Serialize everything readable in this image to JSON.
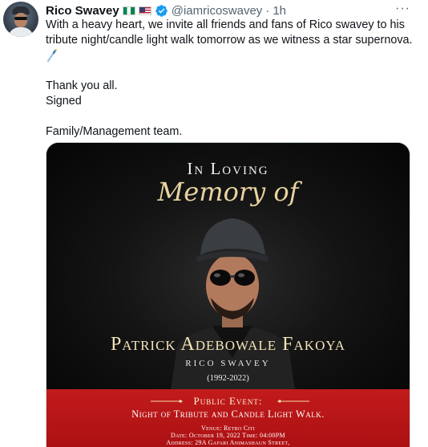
{
  "tweet": {
    "display_name": "Rico Swavey",
    "handle": "@iamricoswavey",
    "separator": "·",
    "time": "1h",
    "more_label": "···",
    "body": {
      "line1": "With a heavy heart, we invite all  friends and fans of Rico swavey to his",
      "line2": "tribute night/candle light walk tomorrow as we witness a star supernova.",
      "thanks": "Thank you all.",
      "signed": "Signed",
      "signature": "Family/Management team."
    },
    "icons": {
      "flag1": "nigeria-flag-icon",
      "flag2": "us-flag-icon",
      "verified": "verified-badge-icon",
      "wand": "magic-wand-emoji-icon"
    },
    "colors": {
      "verified_blue": "#1d9bf0",
      "muted": "#536471",
      "poster_red": "#c21b1b",
      "poster_gold": "#e8d3a0"
    }
  },
  "poster": {
    "in_loving": "In Loving",
    "memory_of": "Memory of",
    "deceased_name": "Patrick Adebowale Fakoya",
    "alias": "RICO SWAVEY",
    "years": "(1992-2022)",
    "public_event": "Public Event:",
    "event_title": "Night of Tribute and Candle Light Walk.",
    "venue": "Venue:  Retro Citi",
    "date_time": "Date: October 19, 2022  Time: 04:00PM",
    "address": "Address:  29A Gafari Animashaun Street,"
  }
}
